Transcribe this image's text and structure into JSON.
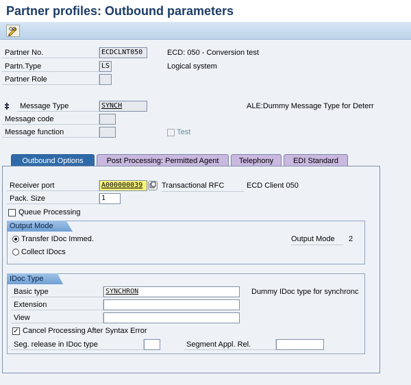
{
  "window": {
    "title": "Partner profiles: Outbound parameters"
  },
  "toolbar": {
    "edit_icon": "pencil-glasses-icon"
  },
  "header": {
    "partner_no_label": "Partner No.",
    "partner_no_value": "ECDCLNT050",
    "partner_no_desc": "ECD: 050 - Conversion test",
    "partn_type_label": "Partn.Type",
    "partn_type_value": "LS",
    "partn_type_desc": "Logical system",
    "partner_role_label": "Partner Role",
    "partner_role_value": "",
    "message_type_label": "Message Type",
    "message_type_value": "SYNCH",
    "message_type_desc": "ALE:Dummy Message Type for Deterr",
    "message_code_label": "Message code",
    "message_code_value": "",
    "message_function_label": "Message function",
    "message_function_value": "",
    "test_label": "Test"
  },
  "tabs": [
    {
      "label": "Outbound Options"
    },
    {
      "label": "Post Processing: Permitted Agent"
    },
    {
      "label": "Telephony"
    },
    {
      "label": "EDI Standard"
    }
  ],
  "outbound": {
    "receiver_port_label": "Receiver port",
    "receiver_port_value": "A000000039",
    "receiver_port_type": "Transactional RFC",
    "receiver_port_desc": "ECD Client 050",
    "pack_size_label": "Pack. Size",
    "pack_size_value": "1",
    "queue_processing_label": "Queue Processing",
    "output_mode": {
      "title": "Output Mode",
      "option_immediate": "Transfer IDoc Immed.",
      "option_collect": "Collect IDocs",
      "output_mode_label": "Output Mode",
      "output_mode_value": "2"
    },
    "idoc_type": {
      "title": "IDoc Type",
      "basic_type_label": "Basic type",
      "basic_type_value": "SYNCHRON",
      "basic_type_desc": "Dummy IDoc type for synchronc",
      "extension_label": "Extension",
      "extension_value": "",
      "view_label": "View",
      "view_value": "",
      "cancel_processing_label": "Cancel Processing After Syntax Error",
      "seg_release_label": "Seg. release in IDoc type",
      "seg_release_value": "",
      "segment_appl_rel_label": "Segment Appl. Rel.",
      "segment_appl_rel_value": ""
    }
  }
}
